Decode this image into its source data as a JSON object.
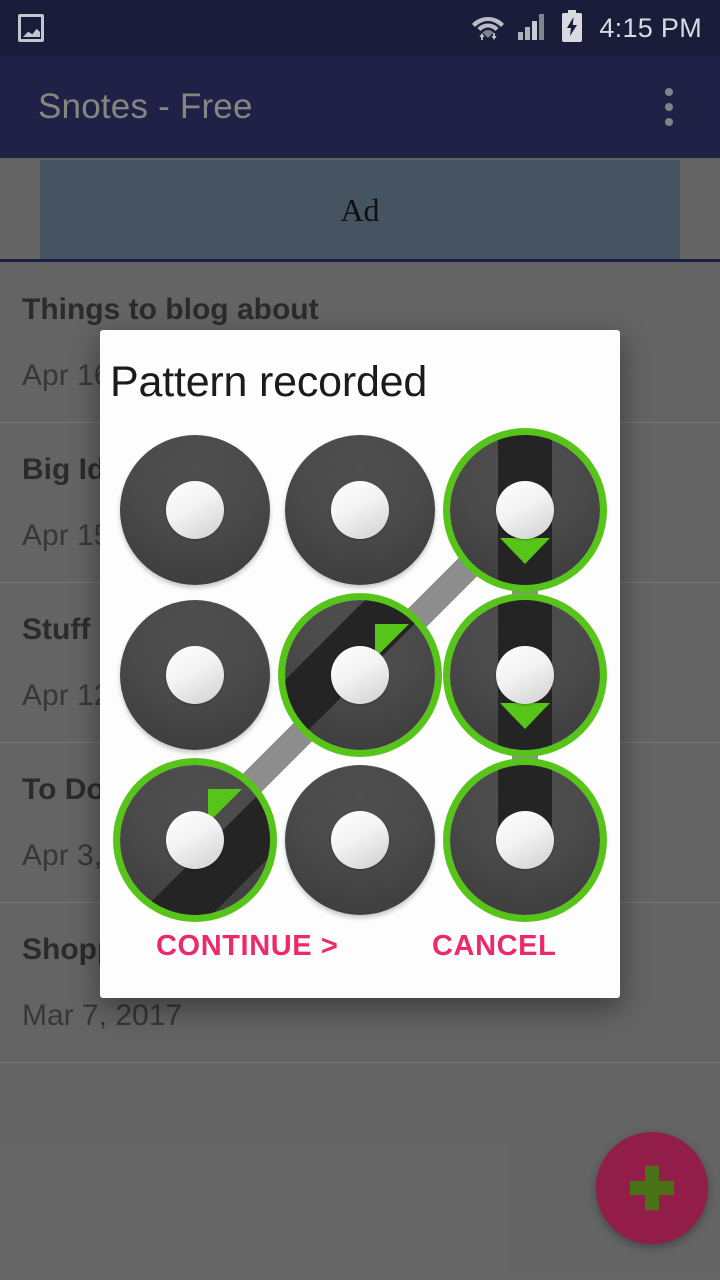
{
  "status_bar": {
    "icons": [
      "gallery-icon",
      "wifi-icon",
      "signal-icon",
      "battery-charging-icon"
    ],
    "clock": "4:15 PM",
    "background": "#1b1f3d"
  },
  "app_bar": {
    "title": "Snotes - Free",
    "overflow_menu": "overflow-menu-icon",
    "background": "#22244c",
    "title_color": "#8f8f87"
  },
  "ad": {
    "label": "Ad",
    "background": "#4a5a67"
  },
  "notes": [
    {
      "title": "Things to blog about",
      "date": "Apr 16"
    },
    {
      "title": "Big Id",
      "date": "Apr 15"
    },
    {
      "title": "Stuff",
      "date": "Apr 12"
    },
    {
      "title": "To Do",
      "date": "Apr 3,"
    },
    {
      "title": "Shopp",
      "date": "Mar 7, 2017"
    }
  ],
  "fab": {
    "label": "+",
    "background": "#9c1f4d",
    "icon_color": "#4e7a18"
  },
  "dialog": {
    "title": "Pattern recorded",
    "continue_label": "CONTINUE >",
    "cancel_label": "CANCEL",
    "accent": "#ec2a6a",
    "background": "#fdfdfd"
  },
  "pattern": {
    "selected_color": "#56c419",
    "line_color": "#8d8d8d",
    "node_color": "#4a4a4a",
    "grid": 3,
    "sequence": [
      6,
      4,
      2,
      5,
      8
    ],
    "selected_nodes": [
      2,
      4,
      5,
      6,
      8
    ],
    "node_states": [
      {
        "id": 0,
        "row": 0,
        "col": 0,
        "selected": false,
        "arrow": null
      },
      {
        "id": 1,
        "row": 0,
        "col": 1,
        "selected": false,
        "arrow": null
      },
      {
        "id": 2,
        "row": 0,
        "col": 2,
        "selected": true,
        "arrow": "down"
      },
      {
        "id": 3,
        "row": 1,
        "col": 0,
        "selected": false,
        "arrow": null
      },
      {
        "id": 4,
        "row": 1,
        "col": 1,
        "selected": true,
        "arrow": "up-right"
      },
      {
        "id": 5,
        "row": 1,
        "col": 2,
        "selected": true,
        "arrow": "down"
      },
      {
        "id": 6,
        "row": 2,
        "col": 0,
        "selected": true,
        "arrow": "up-right"
      },
      {
        "id": 7,
        "row": 2,
        "col": 1,
        "selected": false,
        "arrow": null
      },
      {
        "id": 8,
        "row": 2,
        "col": 2,
        "selected": true,
        "arrow": null
      }
    ]
  }
}
